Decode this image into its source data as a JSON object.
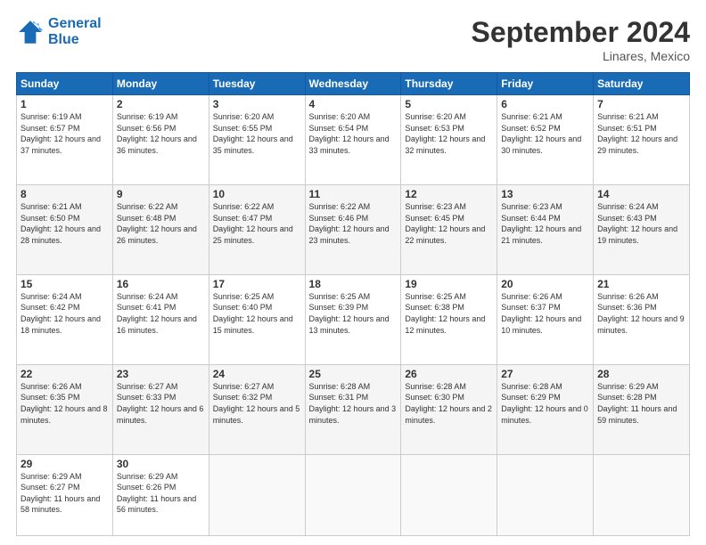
{
  "logo": {
    "line1": "General",
    "line2": "Blue"
  },
  "title": "September 2024",
  "location": "Linares, Mexico",
  "days_header": [
    "Sunday",
    "Monday",
    "Tuesday",
    "Wednesday",
    "Thursday",
    "Friday",
    "Saturday"
  ],
  "weeks": [
    [
      {
        "day": "1",
        "sunrise": "6:19 AM",
        "sunset": "6:57 PM",
        "daylight": "12 hours and 37 minutes."
      },
      {
        "day": "2",
        "sunrise": "6:19 AM",
        "sunset": "6:56 PM",
        "daylight": "12 hours and 36 minutes."
      },
      {
        "day": "3",
        "sunrise": "6:20 AM",
        "sunset": "6:55 PM",
        "daylight": "12 hours and 35 minutes."
      },
      {
        "day": "4",
        "sunrise": "6:20 AM",
        "sunset": "6:54 PM",
        "daylight": "12 hours and 33 minutes."
      },
      {
        "day": "5",
        "sunrise": "6:20 AM",
        "sunset": "6:53 PM",
        "daylight": "12 hours and 32 minutes."
      },
      {
        "day": "6",
        "sunrise": "6:21 AM",
        "sunset": "6:52 PM",
        "daylight": "12 hours and 30 minutes."
      },
      {
        "day": "7",
        "sunrise": "6:21 AM",
        "sunset": "6:51 PM",
        "daylight": "12 hours and 29 minutes."
      }
    ],
    [
      {
        "day": "8",
        "sunrise": "6:21 AM",
        "sunset": "6:50 PM",
        "daylight": "12 hours and 28 minutes."
      },
      {
        "day": "9",
        "sunrise": "6:22 AM",
        "sunset": "6:48 PM",
        "daylight": "12 hours and 26 minutes."
      },
      {
        "day": "10",
        "sunrise": "6:22 AM",
        "sunset": "6:47 PM",
        "daylight": "12 hours and 25 minutes."
      },
      {
        "day": "11",
        "sunrise": "6:22 AM",
        "sunset": "6:46 PM",
        "daylight": "12 hours and 23 minutes."
      },
      {
        "day": "12",
        "sunrise": "6:23 AM",
        "sunset": "6:45 PM",
        "daylight": "12 hours and 22 minutes."
      },
      {
        "day": "13",
        "sunrise": "6:23 AM",
        "sunset": "6:44 PM",
        "daylight": "12 hours and 21 minutes."
      },
      {
        "day": "14",
        "sunrise": "6:24 AM",
        "sunset": "6:43 PM",
        "daylight": "12 hours and 19 minutes."
      }
    ],
    [
      {
        "day": "15",
        "sunrise": "6:24 AM",
        "sunset": "6:42 PM",
        "daylight": "12 hours and 18 minutes."
      },
      {
        "day": "16",
        "sunrise": "6:24 AM",
        "sunset": "6:41 PM",
        "daylight": "12 hours and 16 minutes."
      },
      {
        "day": "17",
        "sunrise": "6:25 AM",
        "sunset": "6:40 PM",
        "daylight": "12 hours and 15 minutes."
      },
      {
        "day": "18",
        "sunrise": "6:25 AM",
        "sunset": "6:39 PM",
        "daylight": "12 hours and 13 minutes."
      },
      {
        "day": "19",
        "sunrise": "6:25 AM",
        "sunset": "6:38 PM",
        "daylight": "12 hours and 12 minutes."
      },
      {
        "day": "20",
        "sunrise": "6:26 AM",
        "sunset": "6:37 PM",
        "daylight": "12 hours and 10 minutes."
      },
      {
        "day": "21",
        "sunrise": "6:26 AM",
        "sunset": "6:36 PM",
        "daylight": "12 hours and 9 minutes."
      }
    ],
    [
      {
        "day": "22",
        "sunrise": "6:26 AM",
        "sunset": "6:35 PM",
        "daylight": "12 hours and 8 minutes."
      },
      {
        "day": "23",
        "sunrise": "6:27 AM",
        "sunset": "6:33 PM",
        "daylight": "12 hours and 6 minutes."
      },
      {
        "day": "24",
        "sunrise": "6:27 AM",
        "sunset": "6:32 PM",
        "daylight": "12 hours and 5 minutes."
      },
      {
        "day": "25",
        "sunrise": "6:28 AM",
        "sunset": "6:31 PM",
        "daylight": "12 hours and 3 minutes."
      },
      {
        "day": "26",
        "sunrise": "6:28 AM",
        "sunset": "6:30 PM",
        "daylight": "12 hours and 2 minutes."
      },
      {
        "day": "27",
        "sunrise": "6:28 AM",
        "sunset": "6:29 PM",
        "daylight": "12 hours and 0 minutes."
      },
      {
        "day": "28",
        "sunrise": "6:29 AM",
        "sunset": "6:28 PM",
        "daylight": "11 hours and 59 minutes."
      }
    ],
    [
      {
        "day": "29",
        "sunrise": "6:29 AM",
        "sunset": "6:27 PM",
        "daylight": "11 hours and 58 minutes."
      },
      {
        "day": "30",
        "sunrise": "6:29 AM",
        "sunset": "6:26 PM",
        "daylight": "11 hours and 56 minutes."
      },
      null,
      null,
      null,
      null,
      null
    ]
  ]
}
